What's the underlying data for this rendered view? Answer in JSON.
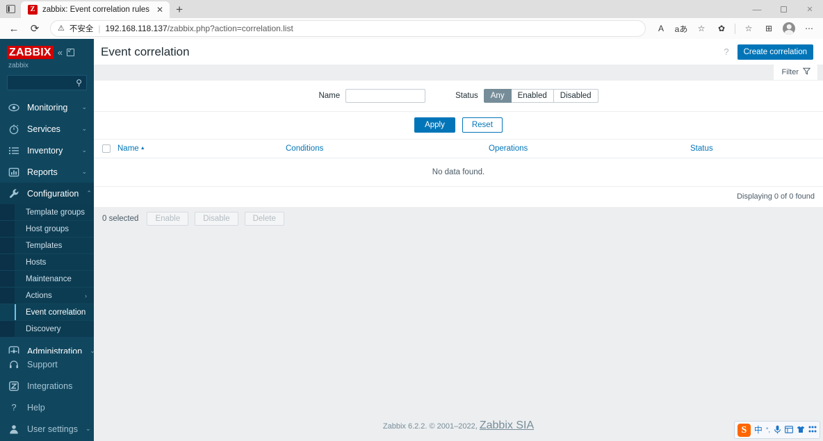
{
  "browser": {
    "tab": {
      "title": "zabbix: Event correlation rules",
      "favicon_letter": "Z",
      "close_icon": "✕"
    },
    "new_tab_label": "+",
    "window_controls": {
      "minimize": "—",
      "maximize": "▢",
      "close": "✕"
    },
    "nav": {
      "back": "←",
      "refresh": "⟳"
    },
    "url": {
      "security_icon": "⚠",
      "security_text": "不安全",
      "separator": "|",
      "host": "192.168.118.137",
      "path": "/zabbix.php?action=correlation.list"
    },
    "toolbar_icons": [
      {
        "name": "read-aloud-icon",
        "glyph": "A"
      },
      {
        "name": "translate-icon",
        "glyph": "aあ"
      },
      {
        "name": "add-favorite-icon",
        "glyph": "☆"
      },
      {
        "name": "browser-essentials-icon",
        "glyph": "✿"
      },
      {
        "name": "favorites-icon",
        "glyph": "☆"
      },
      {
        "name": "collections-icon",
        "glyph": "⊞"
      },
      {
        "name": "profile-icon",
        "glyph": ""
      },
      {
        "name": "settings-more-icon",
        "glyph": "⋯"
      }
    ]
  },
  "sidebar": {
    "logo": "ZABBIX",
    "collapse_icon": "«",
    "compact_icon": "⇱",
    "server_name": "zabbix",
    "search_placeholder": "",
    "search_icon": "search-icon",
    "nav": [
      {
        "label": "Monitoring",
        "icon": "eye-icon",
        "chevron": "⌄"
      },
      {
        "label": "Services",
        "icon": "stopwatch-icon",
        "chevron": "⌄"
      },
      {
        "label": "Inventory",
        "icon": "list-icon",
        "chevron": "⌄"
      },
      {
        "label": "Reports",
        "icon": "bar-chart-icon",
        "chevron": "⌄"
      },
      {
        "label": "Configuration",
        "icon": "wrench-icon",
        "chevron": "⌃"
      }
    ],
    "configuration_submenu": [
      {
        "label": "Template groups",
        "arrow": ""
      },
      {
        "label": "Host groups",
        "arrow": ""
      },
      {
        "label": "Templates",
        "arrow": ""
      },
      {
        "label": "Hosts",
        "arrow": ""
      },
      {
        "label": "Maintenance",
        "arrow": ""
      },
      {
        "label": "Actions",
        "arrow": "›"
      },
      {
        "label": "Event correlation",
        "arrow": ""
      },
      {
        "label": "Discovery",
        "arrow": ""
      }
    ],
    "active_submenu_item": "Event correlation",
    "administration": {
      "label": "Administration",
      "icon": "gear-box-icon",
      "chevron": "⌄"
    },
    "bottom_nav": [
      {
        "label": "Support",
        "icon": "headset-icon",
        "chevron": ""
      },
      {
        "label": "Integrations",
        "icon": "zabbix-box-icon",
        "chevron": ""
      },
      {
        "label": "Help",
        "icon": "question-icon",
        "chevron": ""
      },
      {
        "label": "User settings",
        "icon": "person-icon",
        "chevron": "⌄"
      }
    ]
  },
  "header": {
    "title": "Event correlation",
    "help_icon": "?",
    "create_button": "Create correlation"
  },
  "filter": {
    "tab_label": "Filter",
    "tab_icon": "funnel-icon",
    "name_label": "Name",
    "name_value": "",
    "status_label": "Status",
    "status_options": [
      "Any",
      "Enabled",
      "Disabled"
    ],
    "status_selected": "Any",
    "apply_label": "Apply",
    "reset_label": "Reset"
  },
  "table": {
    "columns": [
      "Name",
      "Conditions",
      "Operations",
      "Status"
    ],
    "sort_column": "Name",
    "sort_arrow": "▲",
    "rows": [],
    "empty_message": "No data found.",
    "displaying_text": "Displaying 0 of 0 found"
  },
  "bulk": {
    "selected_text": "0 selected",
    "buttons": [
      "Enable",
      "Disable",
      "Delete"
    ]
  },
  "footer": {
    "text": "Zabbix 6.2.2. © 2001–2022, ",
    "link": "Zabbix SIA"
  },
  "ime": {
    "logo": "S",
    "items": [
      {
        "name": "chinese-mode-icon",
        "glyph": "中"
      },
      {
        "name": "punctuation-icon",
        "glyph": "°,"
      },
      {
        "name": "voice-input-icon",
        "glyph": "🎤"
      },
      {
        "name": "keyboard-icon",
        "glyph": "⊞"
      },
      {
        "name": "skin-icon",
        "glyph": "👕"
      },
      {
        "name": "toolbox-icon",
        "glyph": "⠿"
      }
    ]
  },
  "colors": {
    "brand_red": "#d40000",
    "sidebar_bg": "#10475f",
    "accent_blue": "#0275b8",
    "panel_gray": "#eceef0"
  }
}
